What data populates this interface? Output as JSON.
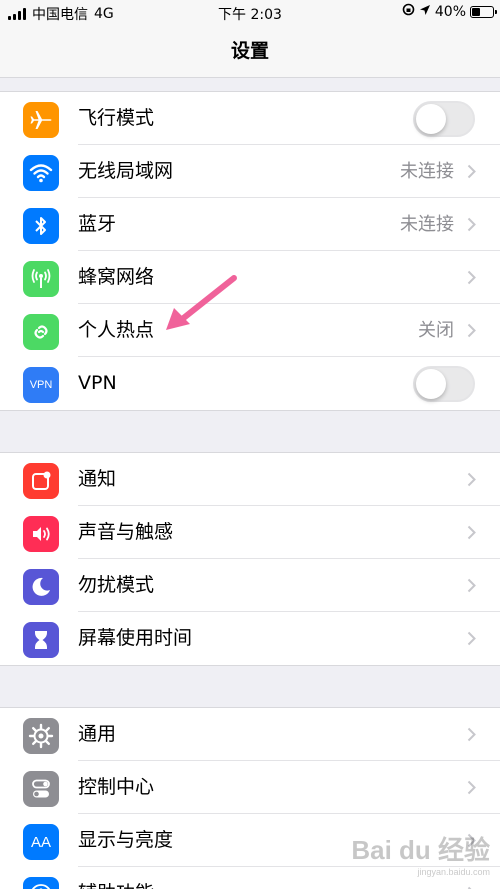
{
  "status": {
    "carrier": "中国电信",
    "network": "4G",
    "time": "下午 2:03",
    "battery_percent": "40%",
    "battery_level": 0.4
  },
  "title": "设置",
  "groups": [
    {
      "rows": [
        {
          "label": "飞行模式",
          "icon": "airplane-icon",
          "color": "#ff9500",
          "accessory": "toggle",
          "on": false
        },
        {
          "label": "无线局域网",
          "icon": "wifi-icon",
          "color": "#007aff",
          "value": "未连接"
        },
        {
          "label": "蓝牙",
          "icon": "bluetooth-icon",
          "color": "#007aff",
          "value": "未连接"
        },
        {
          "label": "蜂窝网络",
          "icon": "cellular-antenna-icon",
          "color": "#4cd964"
        },
        {
          "label": "个人热点",
          "icon": "hotspot-link-icon",
          "color": "#4cd964",
          "value": "关闭"
        },
        {
          "label": "VPN",
          "icon": "vpn-icon",
          "icon_text": "VPN",
          "color": "#2f7cf6",
          "accessory": "toggle",
          "on": false
        }
      ]
    },
    {
      "rows": [
        {
          "label": "通知",
          "icon": "notification-icon",
          "color": "#ff3b30"
        },
        {
          "label": "声音与触感",
          "icon": "speaker-icon",
          "color": "#ff2d55"
        },
        {
          "label": "勿扰模式",
          "icon": "moon-icon",
          "color": "#5856d6"
        },
        {
          "label": "屏幕使用时间",
          "icon": "hourglass-icon",
          "color": "#5856d6"
        }
      ]
    },
    {
      "rows": [
        {
          "label": "通用",
          "icon": "gear-icon",
          "color": "#8e8e93"
        },
        {
          "label": "控制中心",
          "icon": "switches-icon",
          "color": "#8e8e93"
        },
        {
          "label": "显示与亮度",
          "icon": "text-size-icon",
          "icon_text": "AA",
          "color": "#007aff"
        },
        {
          "label": "辅助功能",
          "icon": "accessibility-icon",
          "color": "#007aff"
        }
      ]
    }
  ],
  "annotation": {
    "icon": "pink-arrow-icon",
    "color": "#f0629a"
  },
  "watermark": {
    "main": "Bai du 经验",
    "sub": "jingyan.baidu.com"
  }
}
